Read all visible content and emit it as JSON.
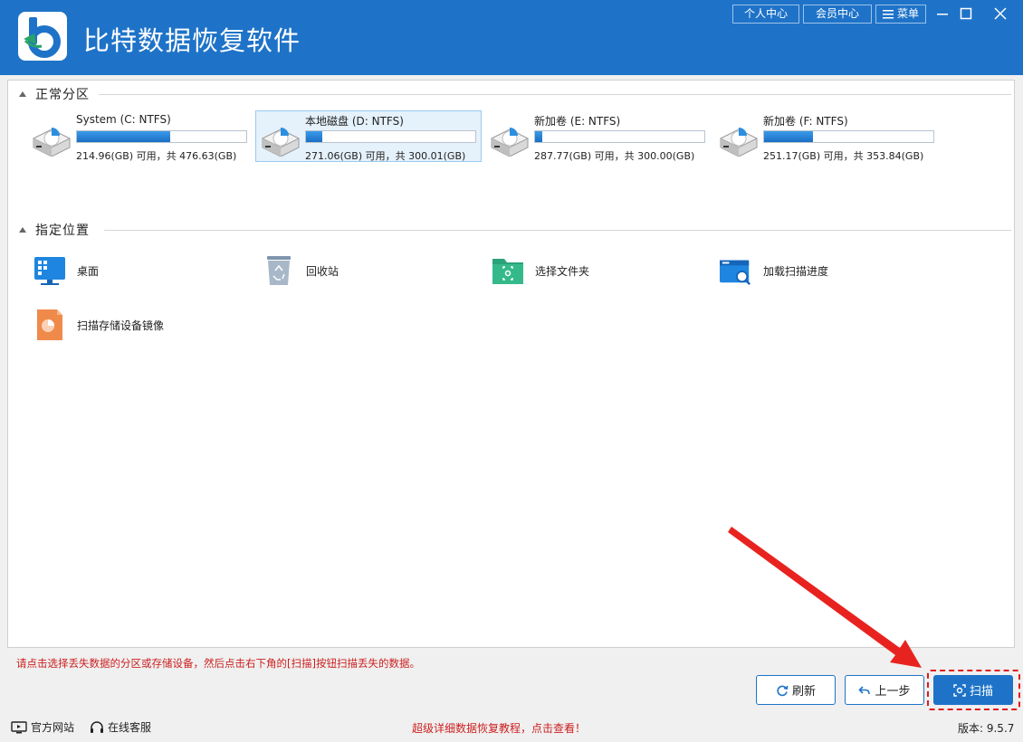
{
  "app": {
    "title": "比特数据恢复软件",
    "accent_color": "#1e73c8"
  },
  "header": {
    "personal_center": "个人中心",
    "member_center": "会员中心",
    "menu": "菜单"
  },
  "sections": {
    "partitions_title": "正常分区",
    "locations_title": "指定位置"
  },
  "drives": [
    {
      "name": "System (C: NTFS)",
      "info": "214.96(GB) 可用，共 476.63(GB)",
      "used_fraction": 0.549,
      "selected": false
    },
    {
      "name": "本地磁盘 (D: NTFS)",
      "info": "271.06(GB) 可用，共 300.01(GB)",
      "used_fraction": 0.096,
      "selected": true
    },
    {
      "name": "新加卷 (E: NTFS)",
      "info": "287.77(GB) 可用，共 300.00(GB)",
      "used_fraction": 0.041,
      "selected": false
    },
    {
      "name": "新加卷 (F: NTFS)",
      "info": "251.17(GB) 可用，共 353.84(GB)",
      "used_fraction": 0.29,
      "selected": false
    }
  ],
  "locations": [
    {
      "label": "桌面",
      "icon": "desktop-icon"
    },
    {
      "label": "回收站",
      "icon": "recycle-bin-icon"
    },
    {
      "label": "选择文件夹",
      "icon": "folder-icon"
    },
    {
      "label": "加载扫描进度",
      "icon": "load-progress-icon"
    },
    {
      "label": "扫描存储设备镜像",
      "icon": "disk-image-icon"
    }
  ],
  "hint": "请点击选择丢失数据的分区或存储设备，然后点击右下角的[扫描]按钮扫描丢失的数据。",
  "buttons": {
    "refresh": "刷新",
    "back": "上一步",
    "scan": "扫描"
  },
  "footer": {
    "website": "官方网站",
    "support": "在线客服",
    "promo": "超级详细数据恢复教程，点击查看！",
    "version": "版本: 9.5.7"
  }
}
